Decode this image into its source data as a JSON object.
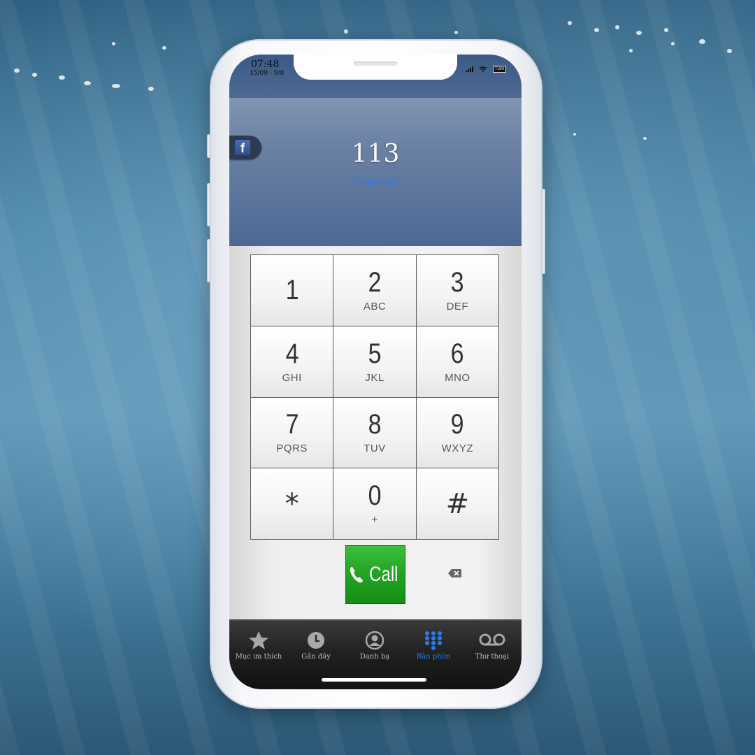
{
  "status_bar": {
    "time": "07:48",
    "date": "15/09 - 9/8",
    "battery": "TGM"
  },
  "display": {
    "number": "113",
    "add_number_link": "Thêm số",
    "facebook_icon": "facebook-icon"
  },
  "keypad": {
    "keys": [
      {
        "digit": "1",
        "letters": ""
      },
      {
        "digit": "2",
        "letters": "ABC"
      },
      {
        "digit": "3",
        "letters": "DEF"
      },
      {
        "digit": "4",
        "letters": "GHI"
      },
      {
        "digit": "5",
        "letters": "JKL"
      },
      {
        "digit": "6",
        "letters": "MNO"
      },
      {
        "digit": "7",
        "letters": "PQRS"
      },
      {
        "digit": "8",
        "letters": "TUV"
      },
      {
        "digit": "9",
        "letters": "WXYZ"
      },
      {
        "digit": "*",
        "letters": ""
      },
      {
        "digit": "0",
        "letters": "+"
      },
      {
        "digit": "#",
        "letters": ""
      }
    ],
    "call_label": "Call",
    "call_color": "#22a322"
  },
  "tabbar": {
    "tabs": [
      {
        "label": "Mục ưa thích",
        "icon": "star-icon",
        "active": false
      },
      {
        "label": "Gần đây",
        "icon": "clock-icon",
        "active": false
      },
      {
        "label": "Danh bạ",
        "icon": "contacts-icon",
        "active": false
      },
      {
        "label": "Bàn phím",
        "icon": "keypad-icon",
        "active": true
      },
      {
        "label": "Thư thoại",
        "icon": "voicemail-icon",
        "active": false
      }
    ],
    "active_color": "#2b7de9"
  }
}
